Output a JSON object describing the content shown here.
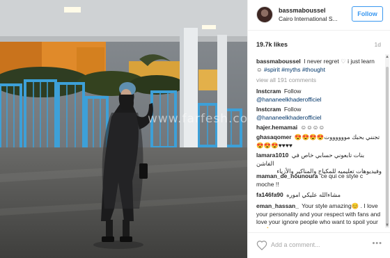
{
  "post": {
    "username": "bassmaboussel",
    "location": "Cairo International S...",
    "follow_label": "Follow",
    "likes": "19.7k likes",
    "age": "1d"
  },
  "watermark": "www.farfesh.com",
  "comments": [
    {
      "user": "bassmaboussel",
      "text": "I never regret ",
      "mark": "♡",
      "text2": "i just learn ☺ ",
      "tags": "#spirit #myths #thought"
    },
    {
      "view_all": "view all 191 comments"
    },
    {
      "user": "Instcram",
      "text": "Follow",
      "tag": "@hananeelkhaderofficiel"
    },
    {
      "user": "Instcram",
      "text": "Follow",
      "tag": "@hananeelkhaderofficiel"
    },
    {
      "user": "hajer.hemamai",
      "text": "☺☺☺☺"
    },
    {
      "user": "ghasaqomer",
      "text": "😍😍😍😍تجنني بحبك مووووووت",
      "text2": "😍😍😍♥♥♥♥"
    },
    {
      "user": "lamara1010",
      "text": "بنات تابعوني حسابي خاص في الفاشن",
      "text2": "وفيديوهات تعليميه للمكياج والمناكير والأزياء"
    },
    {
      "user": "maman_de_nounoura",
      "text": "ce qui ce style c moche !!"
    },
    {
      "user": "fa146fa90",
      "text": "مشاءالله عليكي اموره"
    },
    {
      "user": "eman_hassan_",
      "text": "Your style amazing😊 . I love your personality and your respect with fans and love your ignore people who want to spoil your life👍. Love you"
    }
  ],
  "footer": {
    "placeholder": "Add a comment...",
    "more": "•••"
  },
  "icons": {
    "heart": "heart-outline-icon",
    "more": "more-options-icon",
    "scroll_up": "▲",
    "scroll_down": "▼"
  },
  "colors": {
    "accent": "#3897f0",
    "hashtag": "#003569",
    "muted": "#999999",
    "border": "#efefef"
  }
}
